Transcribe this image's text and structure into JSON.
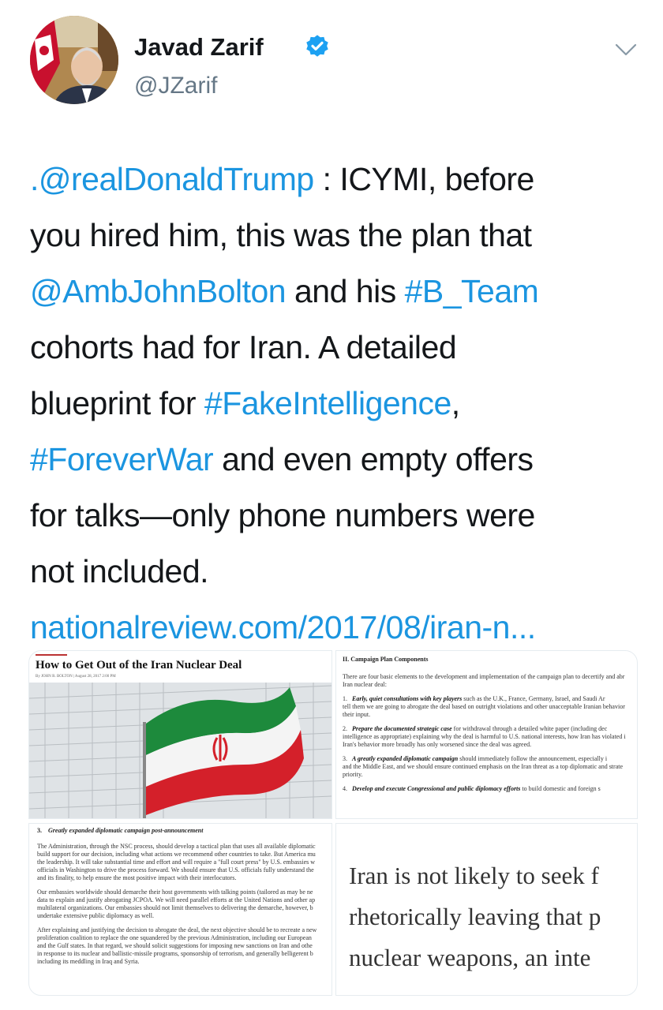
{
  "user": {
    "name": "Javad Zarif",
    "handle": "@JZarif"
  },
  "tweet": {
    "line1_mention": ".@realDonaldTrump",
    "line1_rest": " : ICYMI, before",
    "line2": "you hired him, this was the plan that",
    "line3_mention": "@AmbJohnBolton",
    "line3_mid": " and his ",
    "line3_hashtag": "#B_Team",
    "line4": "cohorts had for Iran. A detailed",
    "line5_pre": "blueprint for ",
    "line5_hashtag": "#FakeIntelligence",
    "line5_post": ",",
    "line6_hashtag": "#ForeverWar",
    "line6_rest": " and even empty offers",
    "line7": "for talks—only phone numbers were",
    "line8": "not included.",
    "link": "nationalreview.com/2017/08/iran-n..."
  },
  "media": {
    "article": {
      "title": "How to Get Out of the Iran Nuclear Deal",
      "byline": "By JOHN R. BOLTON | August 28, 2017 2:00 PM"
    },
    "plan": {
      "heading": "II. Campaign Plan Components",
      "intro1": "There are four basic elements to the development and implementation of the campaign plan to decertify and abr",
      "intro2": "Iran nuclear deal:",
      "i1_num": "1.",
      "i1_bold": "Early, quiet consultations with key players",
      "i1_rest": " such as the U.K., France, Germany, Israel, and Saudi Ar",
      "i1_l2": "tell them we are going to abrogate the deal based on outright violations and other unacceptable Iranian behavior",
      "i1_l3": "their input.",
      "i2_num": "2.",
      "i2_bold": "Prepare the documented strategic case",
      "i2_rest": " for withdrawal through a detailed white paper (including dec",
      "i2_l2": "intelligence as appropriate) explaining why the deal is harmful to U.S. national interests, how Iran has violated i",
      "i2_l3": "Iran's behavior more broadly has only worsened since the deal was agreed.",
      "i3_num": "3.",
      "i3_bold": "A greatly expanded diplomatic campaign",
      "i3_rest": " should immediately follow the announcement, especially i",
      "i3_l2": "and the Middle East, and we should ensure continued emphasis on the Iran threat as a top diplomatic and strate",
      "i3_l3": "priority.",
      "i4_num": "4.",
      "i4_bold": "Develop and execute Congressional and public diplomacy efforts",
      "i4_rest": " to build domestic and foreign s"
    },
    "section3": {
      "heading_num": "3.",
      "heading": "Greatly expanded diplomatic campaign post-announcement",
      "p1": [
        "The Administration, through the NSC process, should develop a tactical plan that uses all available diplomatic",
        "build support for our decision, including what actions we recommend other countries to take. But America mu",
        "the leadership. It will take substantial time and effort and will require a \"full court press\" by U.S. embassies w",
        "officials in Washington to drive the process forward. We should ensure that U.S. officials fully understand the",
        "and its finality, to help ensure the most positive impact with their interlocutors."
      ],
      "p2": [
        "Our embassies worldwide should demarche their host governments with talking points (tailored as may be ne",
        "data to explain and justify abrogating JCPOA. We will need parallel efforts at the United Nations and other ap",
        "multilateral organizations. Our embassies should not limit themselves to delivering the demarche, however, b",
        "undertake extensive public diplomacy as well."
      ],
      "p3": [
        "After explaining and justifying the decision to abrogate the deal, the next objective should be to recreate a new",
        "proliferation coalition to replace the one squandered by the previous Administration, including our European",
        "and the Gulf states. In that regard, we should solicit suggestions for imposing new sanctions on Iran and othe",
        "in response to its nuclear and ballistic-missile programs, sponsorship of terrorism, and generally belligerent b",
        "including its meddling in Iraq and Syria."
      ]
    },
    "quote": {
      "lines": [
        "Iran is not likely to seek f",
        "rhetorically leaving that p",
        "nuclear weapons, an inte"
      ]
    }
  },
  "colors": {
    "link": "#1b95e0",
    "verified": "#1da1f2",
    "text": "#14171a",
    "muted": "#657786"
  },
  "icons": [
    "verified-badge-icon",
    "chevron-down-icon"
  ]
}
